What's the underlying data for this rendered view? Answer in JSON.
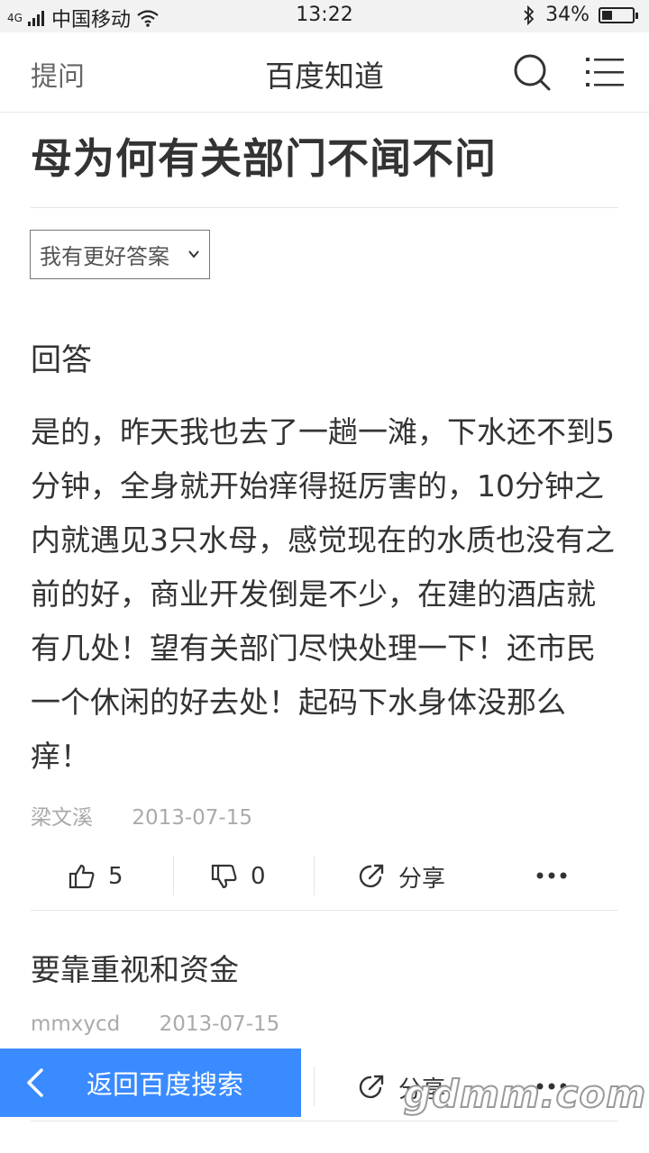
{
  "status_bar": {
    "network": "4G",
    "carrier": "中国移动",
    "time": "13:22",
    "battery": "34%",
    "battery_level": 0.34
  },
  "nav": {
    "ask": "提问",
    "title": "百度知道"
  },
  "question": {
    "title": "母为何有关部门不闻不问"
  },
  "better_answer_select": "我有更好答案",
  "answer_section": {
    "heading": "回答"
  },
  "answers": [
    {
      "body": "是的，昨天我也去了一趟一滩，下水还不到5分钟，全身就开始痒得挺厉害的，10分钟之内就遇见3只水母，感觉现在的水质也没有之前的好，商业开发倒是不少，在建的酒店就有几处！望有关部门尽快处理一下！还市民一个休闲的好去处！起码下水身体没那么痒！",
      "author": "梁文溪",
      "date": "2013-07-15",
      "likes": "5",
      "dislikes": "0",
      "share": "分享"
    },
    {
      "body": "要靠重视和资金",
      "author": "mmxycd",
      "date": "2013-07-15",
      "share": "分享"
    }
  ],
  "back_button": "返回百度搜索",
  "watermark": "gdmm.com",
  "colors": {
    "accent": "#3a8bff",
    "text": "#333333",
    "muted": "#aaaaaa"
  }
}
